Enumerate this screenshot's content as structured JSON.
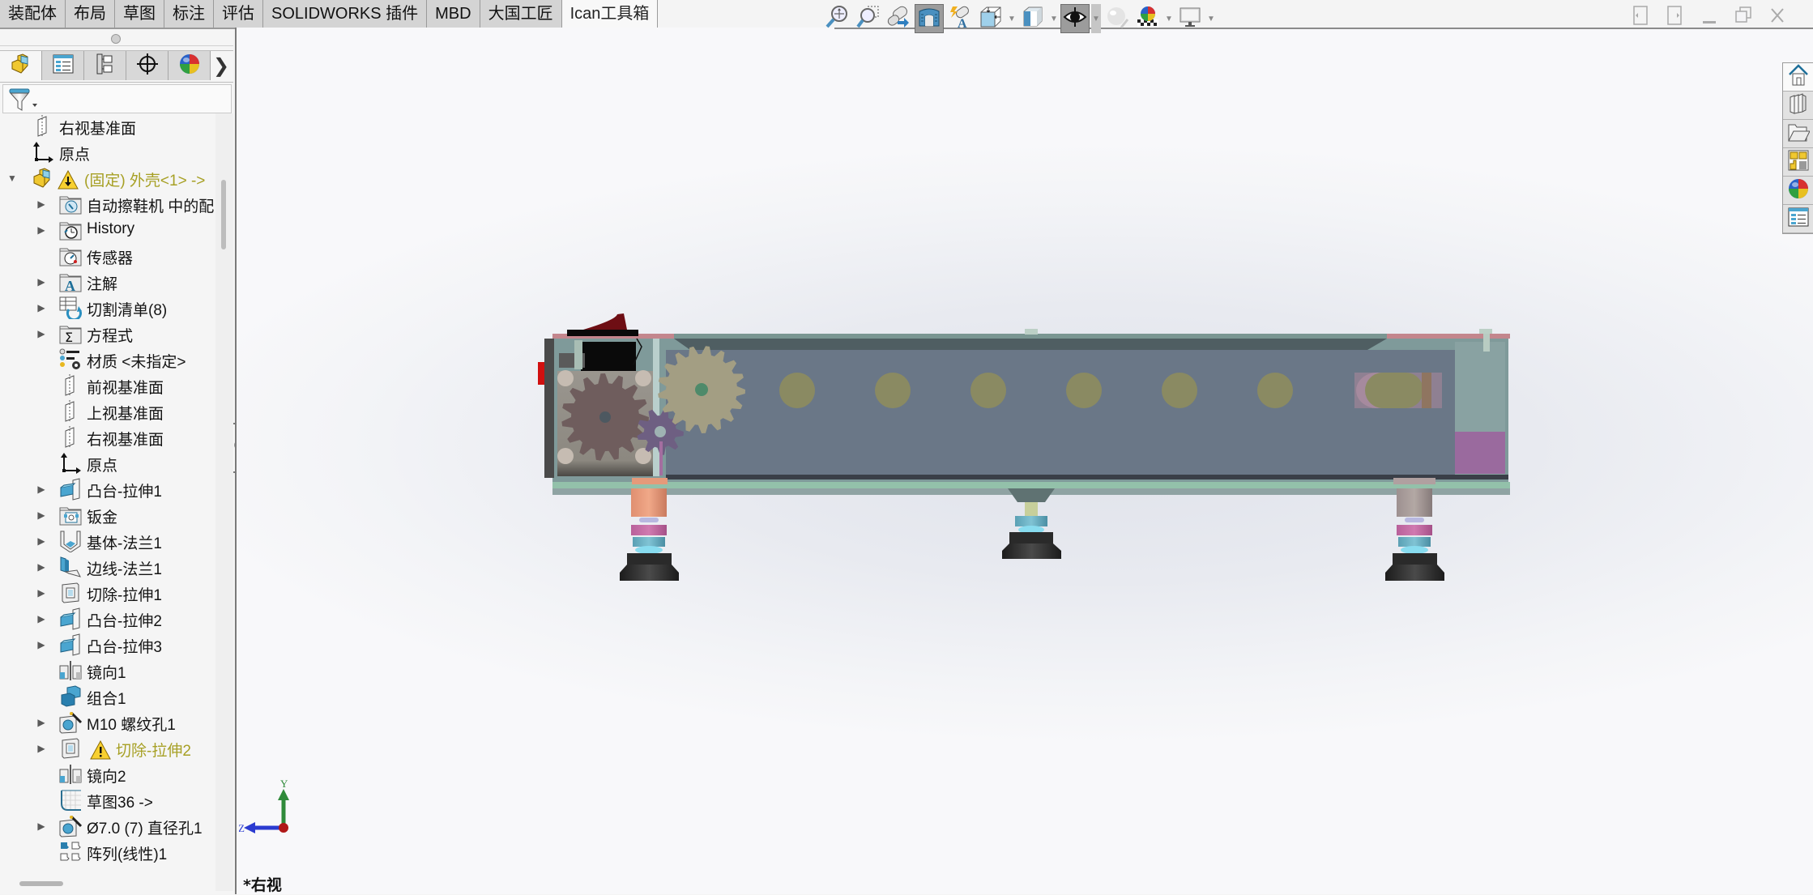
{
  "command_tabs": [
    {
      "label": "装配体",
      "active": false
    },
    {
      "label": "布局",
      "active": false
    },
    {
      "label": "草图",
      "active": false
    },
    {
      "label": "标注",
      "active": false
    },
    {
      "label": "评估",
      "active": false
    },
    {
      "label": "SOLIDWORKS 插件",
      "active": false
    },
    {
      "label": "MBD",
      "active": false
    },
    {
      "label": "大国工匠",
      "active": false
    },
    {
      "label": "Ican工具箱",
      "active": true
    }
  ],
  "heads_up_toolbar": {
    "items": [
      {
        "icon": "zoom-to-fit-icon",
        "has_menu": false,
        "pressed": false
      },
      {
        "icon": "zoom-to-area-icon",
        "has_menu": false,
        "pressed": false
      },
      {
        "icon": "previous-view-icon",
        "has_menu": false,
        "pressed": false
      },
      {
        "icon": "section-view-icon",
        "has_menu": false,
        "pressed": true
      },
      {
        "icon": "dynamic-annotation-views-icon",
        "has_menu": false,
        "pressed": false
      },
      {
        "icon": "view-orientation-icon",
        "has_menu": true,
        "pressed": false
      },
      {
        "icon": "display-style-icon",
        "has_menu": true,
        "pressed": false
      },
      {
        "icon": "hide-show-items-icon",
        "has_menu": true,
        "pressed": true
      },
      {
        "icon": "edit-appearance-icon",
        "has_menu": false,
        "pressed": false
      },
      {
        "icon": "apply-scene-icon",
        "has_menu": true,
        "pressed": false
      },
      {
        "icon": "view-settings-icon",
        "has_menu": true,
        "pressed": false
      }
    ]
  },
  "window_controls": [
    "tile-left-icon",
    "tile-right-icon",
    "minimize-icon",
    "restore-icon",
    "close-icon"
  ],
  "manager_tabs": [
    {
      "name": "feature-manager-tab",
      "icon": "part-icon",
      "active": true
    },
    {
      "name": "property-manager-tab",
      "icon": "property-list-icon",
      "active": false
    },
    {
      "name": "configuration-manager-tab",
      "icon": "configuration-tree-icon",
      "active": false
    },
    {
      "name": "dimxpert-manager-tab",
      "icon": "crosshair-icon",
      "active": false
    },
    {
      "name": "display-manager-tab",
      "icon": "appearance-sphere-icon",
      "active": false
    }
  ],
  "tree": {
    "items": [
      {
        "label": "右视基准面",
        "icon": "plane-icon",
        "level": 1,
        "expandable": false,
        "warning": false
      },
      {
        "label": "原点",
        "icon": "origin-icon",
        "level": 1,
        "expandable": false,
        "warning": false
      },
      {
        "label": "(固定) 外壳<1> ->",
        "icon": "part-icon",
        "level": 0,
        "expandable": true,
        "expanded": true,
        "warning": true
      },
      {
        "label": "自动擦鞋机 中的配合",
        "icon": "mates-folder-icon",
        "level": 2,
        "expandable": true,
        "warning": false
      },
      {
        "label": "History",
        "icon": "history-folder-icon",
        "level": 2,
        "expandable": true,
        "warning": false
      },
      {
        "label": "传感器",
        "icon": "sensors-folder-icon",
        "level": 2,
        "expandable": false,
        "warning": false
      },
      {
        "label": "注解",
        "icon": "annotations-folder-icon",
        "level": 2,
        "expandable": true,
        "warning": false
      },
      {
        "label": "切割清单(8)",
        "icon": "cut-list-icon",
        "level": 2,
        "expandable": true,
        "warning": false
      },
      {
        "label": "方程式",
        "icon": "equations-folder-icon",
        "level": 2,
        "expandable": true,
        "warning": false
      },
      {
        "label": "材质 <未指定>",
        "icon": "material-icon",
        "level": 2,
        "expandable": false,
        "warning": false
      },
      {
        "label": "前视基准面",
        "icon": "plane-icon",
        "level": 2,
        "expandable": false,
        "warning": false
      },
      {
        "label": "上视基准面",
        "icon": "plane-icon",
        "level": 2,
        "expandable": false,
        "warning": false
      },
      {
        "label": "右视基准面",
        "icon": "plane-icon",
        "level": 2,
        "expandable": false,
        "warning": false
      },
      {
        "label": "原点",
        "icon": "origin-icon",
        "level": 2,
        "expandable": false,
        "warning": false
      },
      {
        "label": "凸台-拉伸1",
        "icon": "boss-extrude-icon",
        "level": 2,
        "expandable": true,
        "warning": false
      },
      {
        "label": "钣金",
        "icon": "sheet-metal-icon",
        "level": 2,
        "expandable": true,
        "warning": false
      },
      {
        "label": "基体-法兰1",
        "icon": "base-flange-icon",
        "level": 2,
        "expandable": true,
        "warning": false
      },
      {
        "label": "边线-法兰1",
        "icon": "edge-flange-icon",
        "level": 2,
        "expandable": true,
        "warning": false
      },
      {
        "label": "切除-拉伸1",
        "icon": "cut-extrude-icon",
        "level": 2,
        "expandable": true,
        "warning": false
      },
      {
        "label": "凸台-拉伸2",
        "icon": "boss-extrude-icon",
        "level": 2,
        "expandable": true,
        "warning": false
      },
      {
        "label": "凸台-拉伸3",
        "icon": "boss-extrude-icon",
        "level": 2,
        "expandable": true,
        "warning": false
      },
      {
        "label": "镜向1",
        "icon": "mirror-icon",
        "level": 2,
        "expandable": false,
        "warning": false
      },
      {
        "label": "组合1",
        "icon": "combine-icon",
        "level": 2,
        "expandable": false,
        "warning": false
      },
      {
        "label": "M10 螺纹孔1",
        "icon": "hole-wizard-icon",
        "level": 2,
        "expandable": true,
        "warning": false
      },
      {
        "label": "切除-拉伸2",
        "icon": "cut-extrude-icon",
        "level": 2,
        "expandable": true,
        "warning": true
      },
      {
        "label": "镜向2",
        "icon": "mirror-icon",
        "level": 2,
        "expandable": false,
        "warning": false
      },
      {
        "label": "草图36 ->",
        "icon": "sketch-icon",
        "level": 2,
        "expandable": false,
        "warning": false
      },
      {
        "label": "Ø7.0 (7) 直径孔1",
        "icon": "hole-wizard-icon",
        "level": 2,
        "expandable": true,
        "warning": false
      },
      {
        "label": "阵列(线性)1",
        "icon": "linear-pattern-icon",
        "level": 2,
        "expandable": false,
        "warning": false
      }
    ]
  },
  "task_pane": [
    {
      "name": "solidworks-resources",
      "icon": "home-icon",
      "active": true
    },
    {
      "name": "design-library",
      "icon": "library-books-icon",
      "active": false
    },
    {
      "name": "file-explorer",
      "icon": "folder-icon",
      "active": false
    },
    {
      "name": "view-palette",
      "icon": "view-palette-icon",
      "active": false
    },
    {
      "name": "appearances-scenes",
      "icon": "appearance-sphere-icon",
      "active": false
    },
    {
      "name": "custom-properties",
      "icon": "property-list-icon",
      "active": false
    }
  ],
  "viewport": {
    "view_name": "*右视",
    "triad": {
      "axis_up": "Y",
      "axis_left": "Z"
    }
  },
  "colors": {
    "warning_text": "#a7a025",
    "frame_top": "#c3868d",
    "body": "#6a7787",
    "rail": "#93c1aa",
    "hole": "#8a8a62"
  }
}
